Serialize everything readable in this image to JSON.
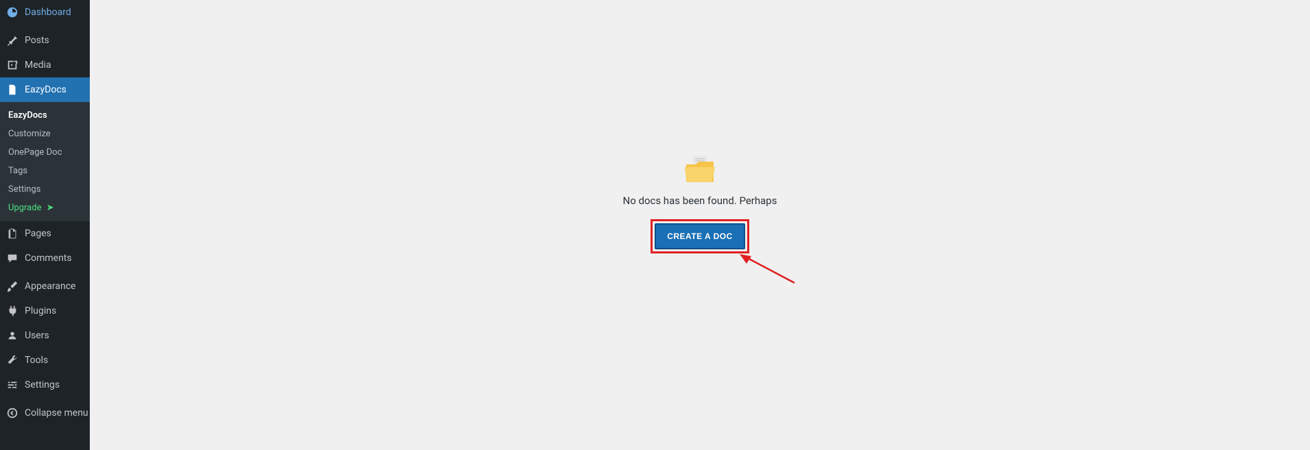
{
  "sidebar": {
    "menu": [
      {
        "id": "dashboard",
        "label": "Dashboard",
        "icon": "dashboard"
      },
      {
        "id": "posts",
        "label": "Posts",
        "icon": "pin"
      },
      {
        "id": "media",
        "label": "Media",
        "icon": "media"
      },
      {
        "id": "eazydocs",
        "label": "EazyDocs",
        "icon": "doc",
        "active": true
      }
    ],
    "submenu": [
      {
        "id": "eazydocs-main",
        "label": "EazyDocs",
        "current": true
      },
      {
        "id": "customize",
        "label": "Customize"
      },
      {
        "id": "onepage",
        "label": "OnePage Doc"
      },
      {
        "id": "tags",
        "label": "Tags"
      },
      {
        "id": "settings-sub",
        "label": "Settings"
      },
      {
        "id": "upgrade",
        "label": "Upgrade",
        "upgrade": true,
        "arrow": "➤"
      }
    ],
    "menu2": [
      {
        "id": "pages",
        "label": "Pages",
        "icon": "pages"
      },
      {
        "id": "comments",
        "label": "Comments",
        "icon": "comment"
      }
    ],
    "menu3": [
      {
        "id": "appearance",
        "label": "Appearance",
        "icon": "brush"
      },
      {
        "id": "plugins",
        "label": "Plugins",
        "icon": "plug"
      },
      {
        "id": "users",
        "label": "Users",
        "icon": "user"
      },
      {
        "id": "tools",
        "label": "Tools",
        "icon": "wrench"
      },
      {
        "id": "settings",
        "label": "Settings",
        "icon": "sliders"
      }
    ],
    "collapse": {
      "label": "Collapse menu"
    }
  },
  "main": {
    "empty_message": "No docs has been found. Perhaps",
    "create_button": "CREATE A DOC"
  }
}
